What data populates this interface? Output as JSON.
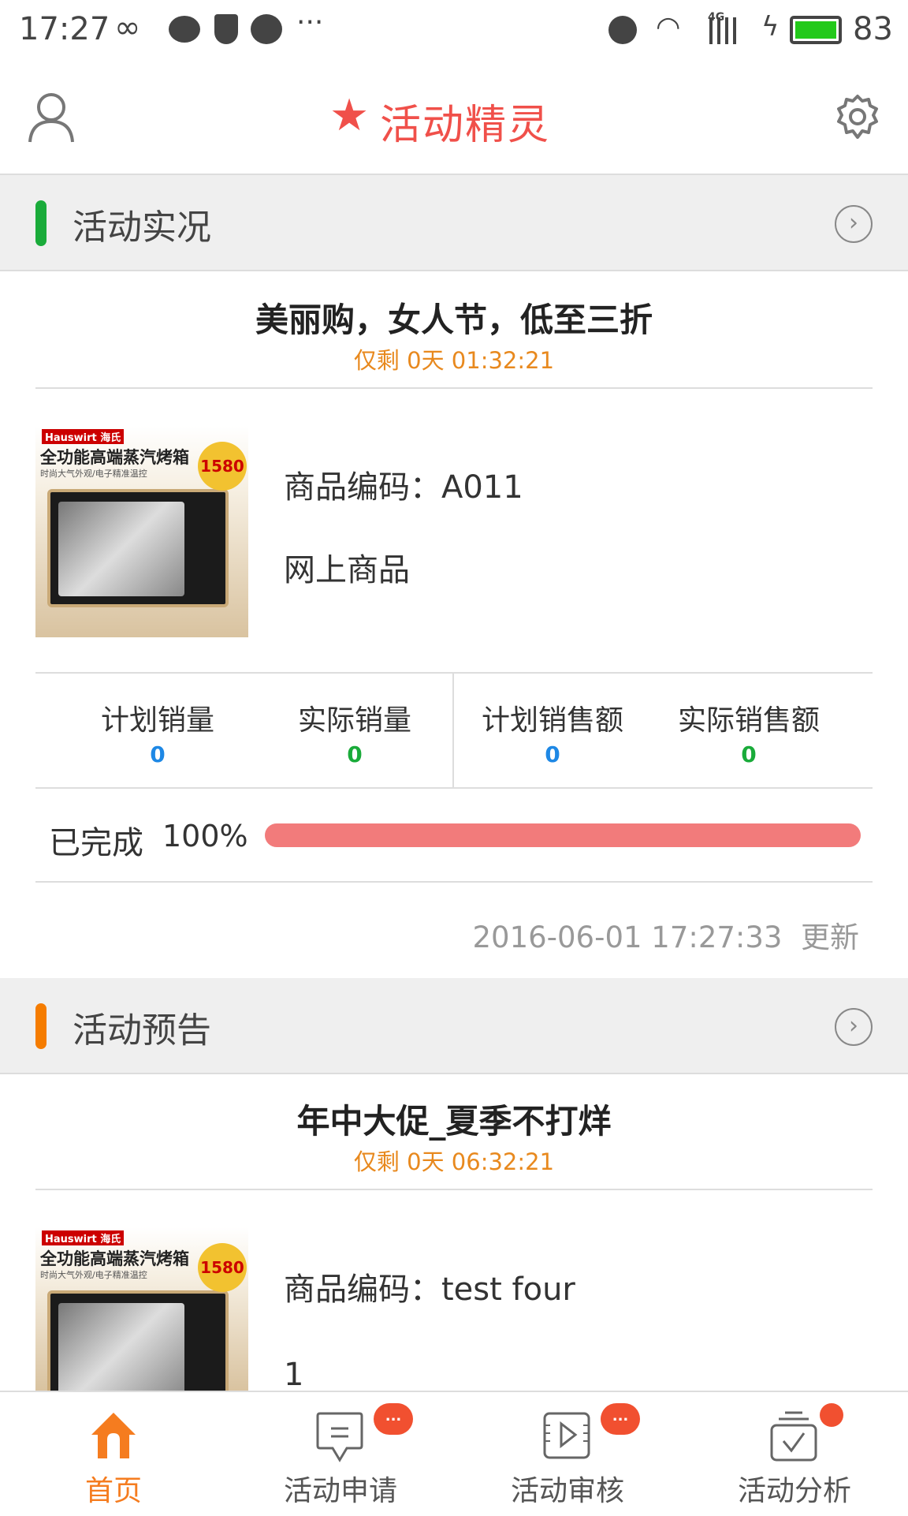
{
  "status_bar": {
    "time": "17:27",
    "battery": "83",
    "network": "4G",
    "icons": [
      "infinity-icon",
      "chat-bubble-icon",
      "shield-icon",
      "wechat-icon",
      "more-icon",
      "alarm-icon",
      "wifi-icon",
      "signal-icon",
      "charging-icon",
      "battery-icon"
    ]
  },
  "header": {
    "title": "活动精灵",
    "left_icon": "user-icon",
    "right_icon": "settings-gear-icon",
    "accent": "#f0504a"
  },
  "live": {
    "section_title": "活动实况",
    "accent": "#1aab3a",
    "title": "美丽购，女人节，低至三折",
    "countdown": "仅剩 0天 01:32:21",
    "product": {
      "image_brand": "Hauswirt 海氏",
      "image_headline": "全功能高端蒸汽烤箱",
      "image_sub": "时尚大气外观/电子精准温控",
      "image_price": "1580",
      "code": "商品编码：A011",
      "type": "网上商品"
    },
    "stats": [
      {
        "label": "计划销量",
        "value": "0",
        "color": "#1e88e5"
      },
      {
        "label": "实际销量",
        "value": "0",
        "color": "#1aab3a"
      },
      {
        "label": "计划销售额",
        "value": "0",
        "color": "#1e88e5"
      },
      {
        "label": "实际销售额",
        "value": "0",
        "color": "#1aab3a"
      }
    ],
    "progress_label": "已完成",
    "progress_text": "100%",
    "progress": 1.0,
    "progress_color": "#f27b7b",
    "updated": "2016-06-01 17:27:33",
    "updated_suffix": "更新"
  },
  "preview": {
    "section_title": "活动预告",
    "accent": "#f57c00",
    "title": "年中大促_夏季不打烊",
    "countdown": "仅剩 0天 06:32:21",
    "product": {
      "image_brand": "Hauswirt 海氏",
      "image_headline": "全功能高端蒸汽烤箱",
      "image_sub": "时尚大气外观/电子精准温控",
      "image_price": "1580",
      "code": "商品编码：test four",
      "type": "1"
    }
  },
  "nav": {
    "items": [
      {
        "label": "首页",
        "icon": "home-icon",
        "active": true
      },
      {
        "label": "活动申请",
        "icon": "message-icon",
        "badge": "..."
      },
      {
        "label": "活动审核",
        "icon": "review-play-icon",
        "badge": "..."
      },
      {
        "label": "活动分析",
        "icon": "analysis-check-icon",
        "badge_dot": true
      }
    ],
    "active_color": "#f57c1f"
  }
}
